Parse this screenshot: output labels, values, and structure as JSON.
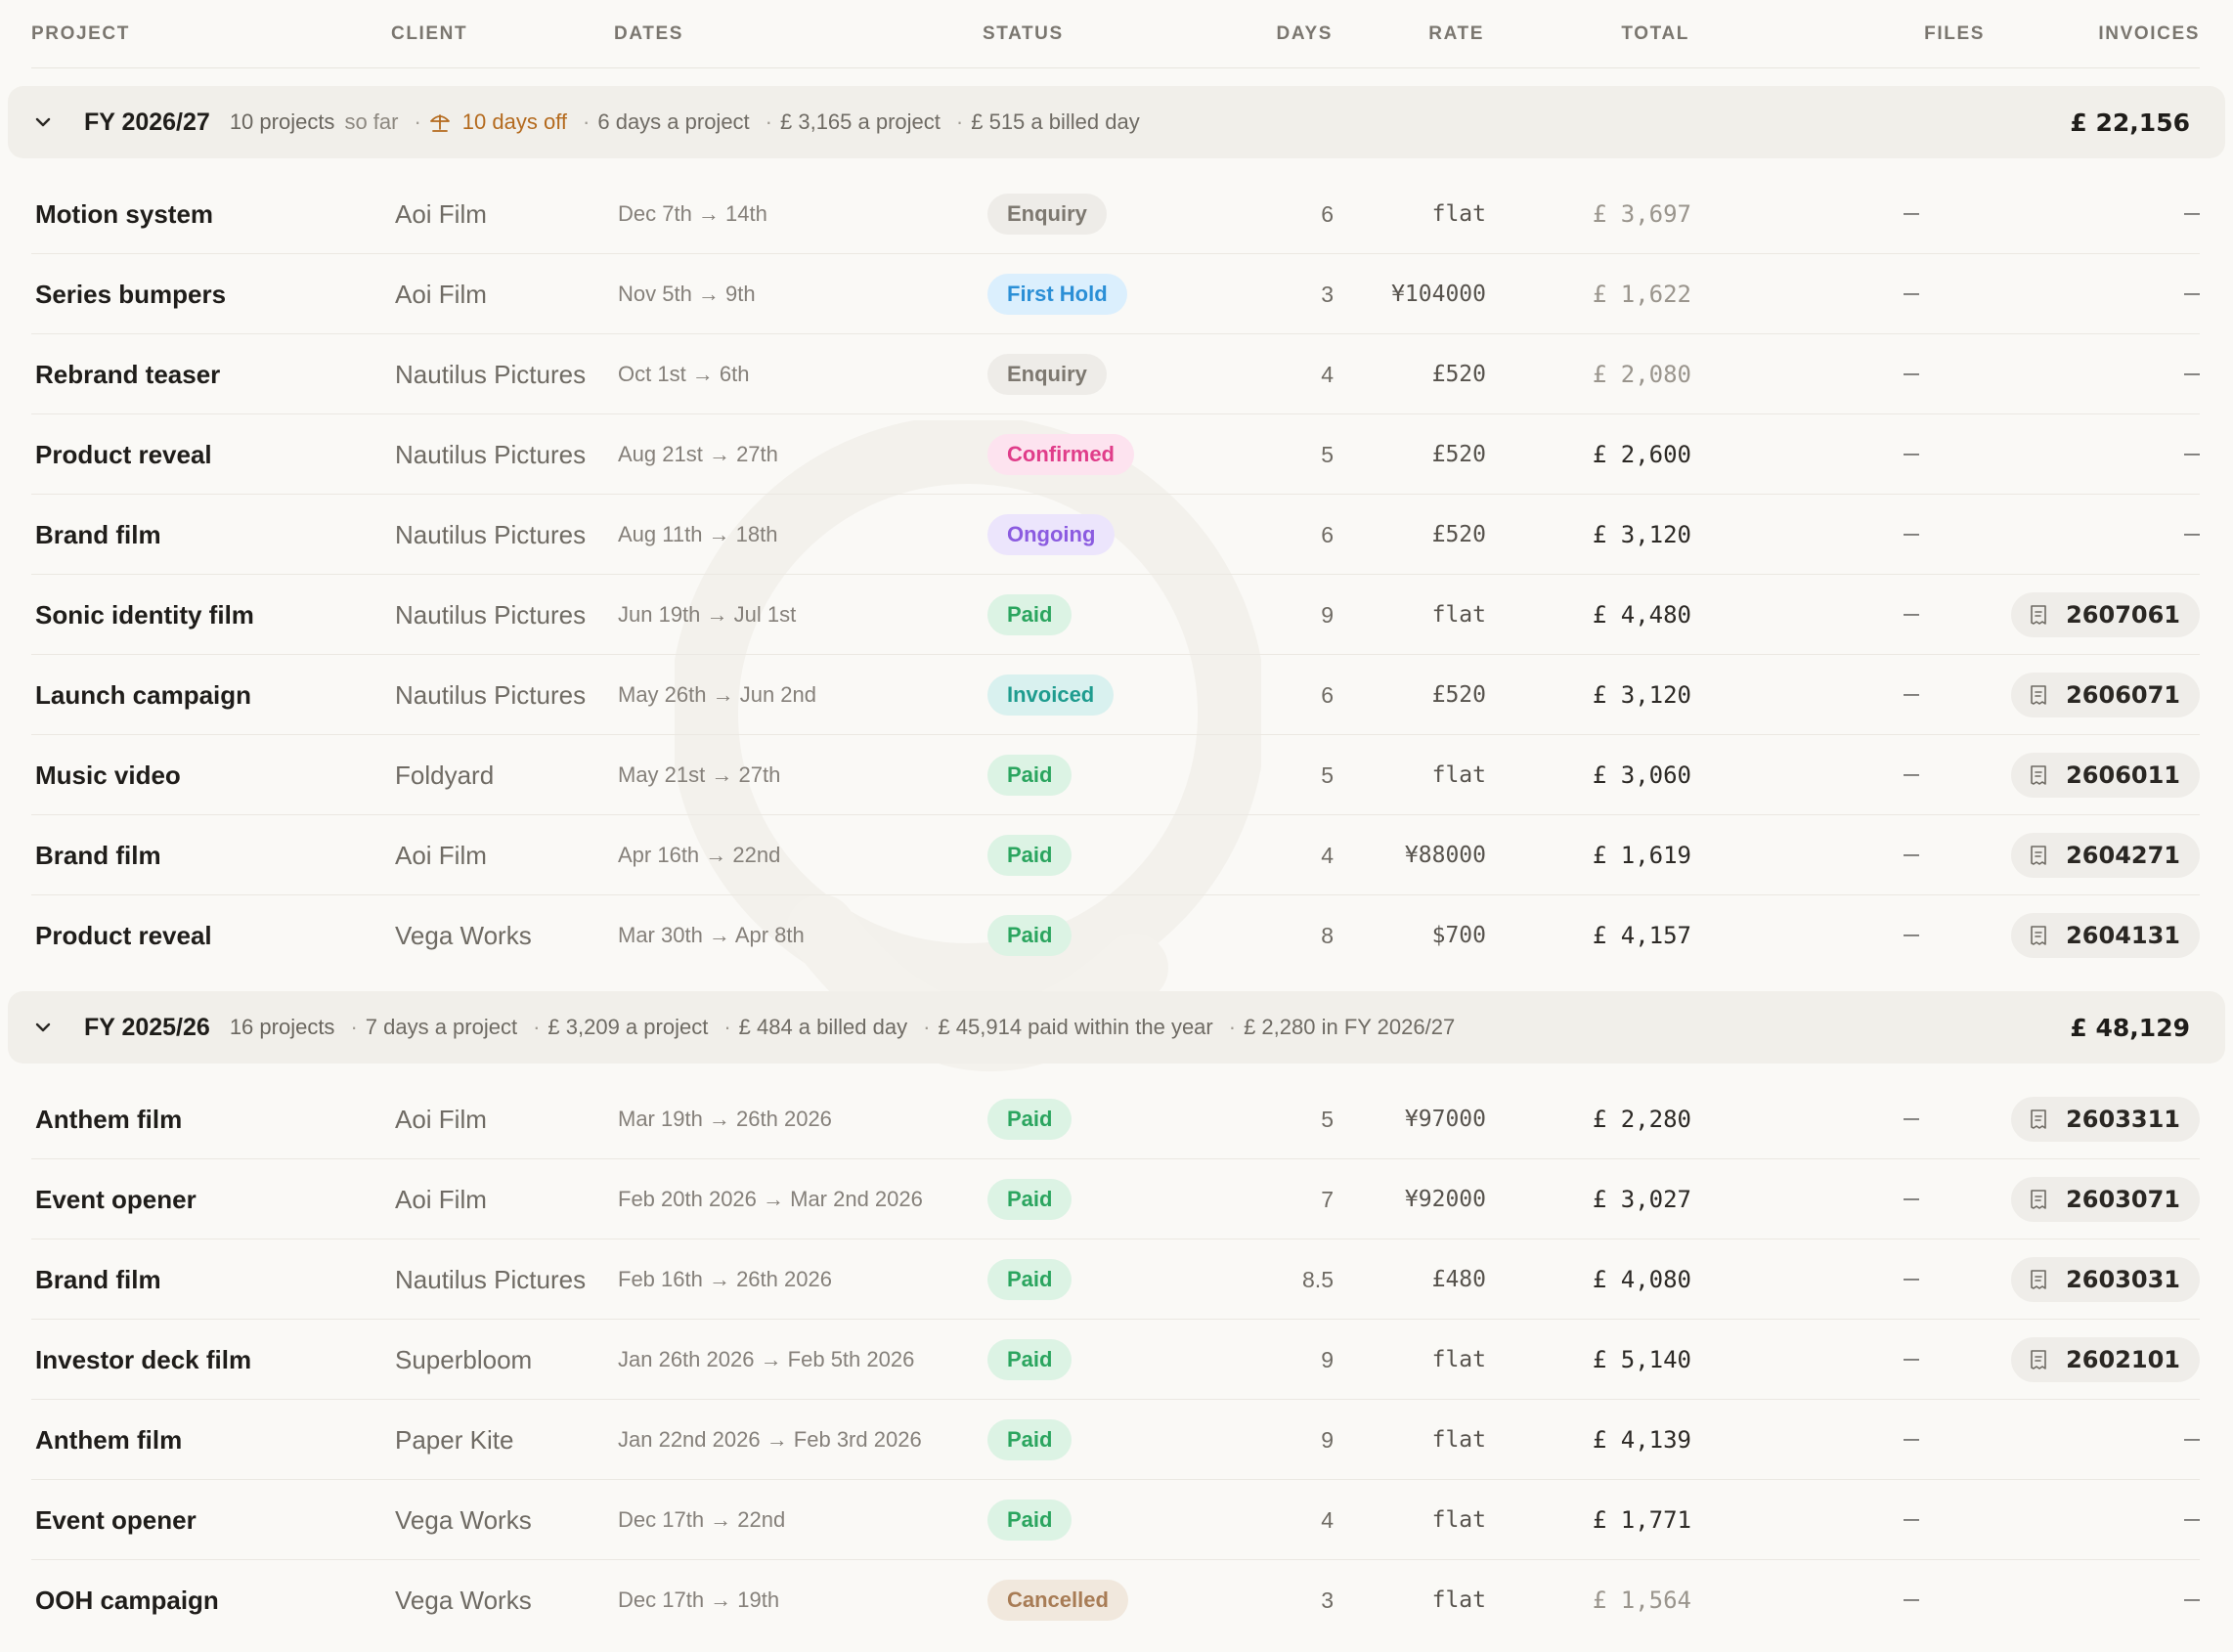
{
  "columns": {
    "project": "PROJECT",
    "client": "CLIENT",
    "dates": "DATES",
    "status": "STATUS",
    "days": "DAYS",
    "rate": "RATE",
    "total": "TOTAL",
    "files": "FILES",
    "invoices": "INVOICES"
  },
  "groups": [
    {
      "title": "FY 2026/27",
      "projects_count": "10 projects",
      "projects_suffix": "so far",
      "days_off": "10 days off",
      "days_per_project": "6 days a project",
      "per_project": "£ 3,165 a project",
      "per_billed_day": "£ 515 a billed day",
      "total": "£ 22,156",
      "rows": [
        {
          "project": "Motion system",
          "client": "Aoi Film",
          "dates": "Dec 7th → 14th",
          "status": "Enquiry",
          "status_kind": "enquiry",
          "days": "6",
          "rate": "flat",
          "total": "£ 3,697",
          "total_dim": true,
          "files": "—",
          "invoice": ""
        },
        {
          "project": "Series bumpers",
          "client": "Aoi Film",
          "dates": "Nov 5th → 9th",
          "status": "First Hold",
          "status_kind": "firsthold",
          "days": "3",
          "rate": "¥104000",
          "total": "£ 1,622",
          "total_dim": true,
          "files": "—",
          "invoice": ""
        },
        {
          "project": "Rebrand teaser",
          "client": "Nautilus Pictures",
          "dates": "Oct 1st → 6th",
          "status": "Enquiry",
          "status_kind": "enquiry",
          "days": "4",
          "rate": "£520",
          "total": "£ 2,080",
          "total_dim": true,
          "files": "—",
          "invoice": ""
        },
        {
          "project": "Product reveal",
          "client": "Nautilus Pictures",
          "dates": "Aug 21st → 27th",
          "status": "Confirmed",
          "status_kind": "confirmed",
          "days": "5",
          "rate": "£520",
          "total": "£ 2,600",
          "total_dim": false,
          "files": "—",
          "invoice": ""
        },
        {
          "project": "Brand film",
          "client": "Nautilus Pictures",
          "dates": "Aug 11th → 18th",
          "status": "Ongoing",
          "status_kind": "ongoing",
          "days": "6",
          "rate": "£520",
          "total": "£ 3,120",
          "total_dim": false,
          "files": "—",
          "invoice": ""
        },
        {
          "project": "Sonic identity film",
          "client": "Nautilus Pictures",
          "dates": "Jun 19th → Jul 1st",
          "status": "Paid",
          "status_kind": "paid",
          "days": "9",
          "rate": "flat",
          "total": "£ 4,480",
          "total_dim": false,
          "files": "—",
          "invoice": "2607061"
        },
        {
          "project": "Launch campaign",
          "client": "Nautilus Pictures",
          "dates": "May 26th → Jun 2nd",
          "status": "Invoiced",
          "status_kind": "invoiced",
          "days": "6",
          "rate": "£520",
          "total": "£ 3,120",
          "total_dim": false,
          "files": "—",
          "invoice": "2606071"
        },
        {
          "project": "Music video",
          "client": "Foldyard",
          "dates": "May 21st → 27th",
          "status": "Paid",
          "status_kind": "paid",
          "days": "5",
          "rate": "flat",
          "total": "£ 3,060",
          "total_dim": false,
          "files": "—",
          "invoice": "2606011"
        },
        {
          "project": "Brand film",
          "client": "Aoi Film",
          "dates": "Apr 16th → 22nd",
          "status": "Paid",
          "status_kind": "paid",
          "days": "4",
          "rate": "¥88000",
          "total": "£ 1,619",
          "total_dim": false,
          "files": "—",
          "invoice": "2604271"
        },
        {
          "project": "Product reveal",
          "client": "Vega Works",
          "dates": "Mar 30th → Apr 8th",
          "status": "Paid",
          "status_kind": "paid",
          "days": "8",
          "rate": "$700",
          "total": "£ 4,157",
          "total_dim": false,
          "files": "—",
          "invoice": "2604131"
        }
      ]
    },
    {
      "title": "FY 2025/26",
      "projects_count": "16 projects",
      "days_per_project": "7 days a project",
      "per_project": "£ 3,209 a project",
      "per_billed_day": "£ 484 a billed day",
      "paid_within": "£ 45,914 paid within the year",
      "carried": "£ 2,280 in FY 2026/27",
      "total": "£ 48,129",
      "rows": [
        {
          "project": "Anthem film",
          "client": "Aoi Film",
          "dates": "Mar 19th → 26th 2026",
          "status": "Paid",
          "status_kind": "paid",
          "days": "5",
          "rate": "¥97000",
          "total": "£ 2,280",
          "total_dim": false,
          "files": "—",
          "invoice": "2603311"
        },
        {
          "project": "Event opener",
          "client": "Aoi Film",
          "dates": "Feb 20th 2026 → Mar 2nd 2026",
          "status": "Paid",
          "status_kind": "paid",
          "days": "7",
          "rate": "¥92000",
          "total": "£ 3,027",
          "total_dim": false,
          "files": "—",
          "invoice": "2603071"
        },
        {
          "project": "Brand film",
          "client": "Nautilus Pictures",
          "dates": "Feb 16th → 26th 2026",
          "status": "Paid",
          "status_kind": "paid",
          "days": "8.5",
          "rate": "£480",
          "total": "£ 4,080",
          "total_dim": false,
          "files": "—",
          "invoice": "2603031"
        },
        {
          "project": "Investor deck film",
          "client": "Superbloom",
          "dates": "Jan 26th 2026 → Feb 5th 2026",
          "status": "Paid",
          "status_kind": "paid",
          "days": "9",
          "rate": "flat",
          "total": "£ 5,140",
          "total_dim": false,
          "files": "—",
          "invoice": "2602101"
        },
        {
          "project": "Anthem film",
          "client": "Paper Kite",
          "dates": "Jan 22nd 2026 → Feb 3rd 2026",
          "status": "Paid",
          "status_kind": "paid",
          "days": "9",
          "rate": "flat",
          "total": "£ 4,139",
          "total_dim": false,
          "files": "—",
          "invoice": ""
        },
        {
          "project": "Event opener",
          "client": "Vega Works",
          "dates": "Dec 17th → 22nd",
          "status": "Paid",
          "status_kind": "paid",
          "days": "4",
          "rate": "flat",
          "total": "£ 1,771",
          "total_dim": false,
          "files": "—",
          "invoice": ""
        },
        {
          "project": "OOH campaign",
          "client": "Vega Works",
          "dates": "Dec 17th → 19th",
          "status": "Cancelled",
          "status_kind": "cancelled",
          "days": "3",
          "rate": "flat",
          "total": "£ 1,564",
          "total_dim": true,
          "files": "—",
          "invoice": ""
        }
      ]
    }
  ],
  "empty_marker": "—",
  "icons": {
    "collapse": "chevron-down-icon",
    "days_off": "beach-umbrella-icon",
    "invoice": "receipt-icon"
  },
  "colors": {
    "background": "#faf9f6",
    "group_background": "#f1efea",
    "days_off": "#b46a1e"
  }
}
